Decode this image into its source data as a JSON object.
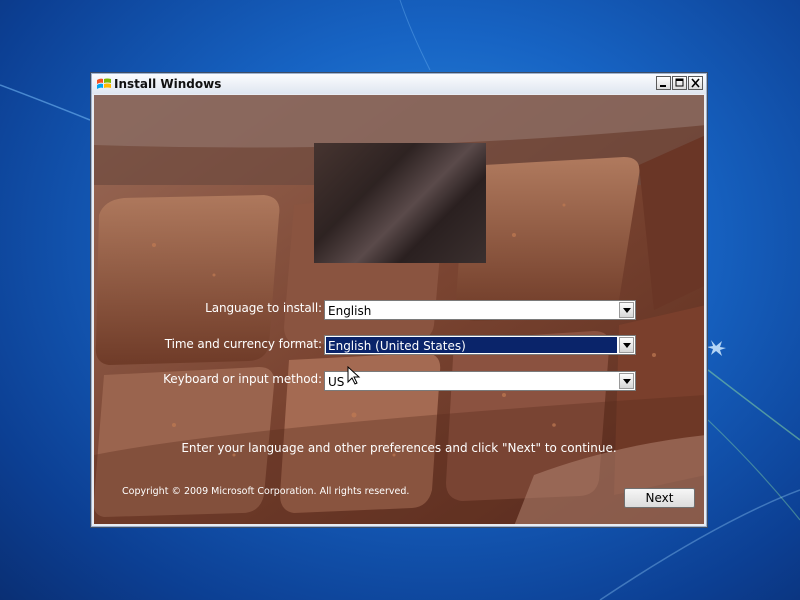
{
  "window": {
    "title": "Install Windows"
  },
  "form": {
    "language_label": "Language to install:",
    "language_value": "English",
    "time_label": "Time and currency format:",
    "time_value": "English (United States)",
    "keyboard_label": "Keyboard or input method:",
    "keyboard_value": "US"
  },
  "instruction": "Enter your language and other preferences and click \"Next\" to continue.",
  "copyright": "Copyright © 2009 Microsoft Corporation. All rights reserved.",
  "buttons": {
    "next_label": "Next"
  },
  "icons": {
    "window_logo": "windows-logo-icon",
    "minimize": "minimize-icon",
    "maximize": "maximize-icon",
    "close": "close-icon",
    "dropdown": "chevron-down-icon",
    "cursor": "mouse-pointer-icon"
  },
  "colors": {
    "desktop_blue": "#1764c4",
    "selection": "#0a246a",
    "background_chocolate": "#6b3a28"
  }
}
